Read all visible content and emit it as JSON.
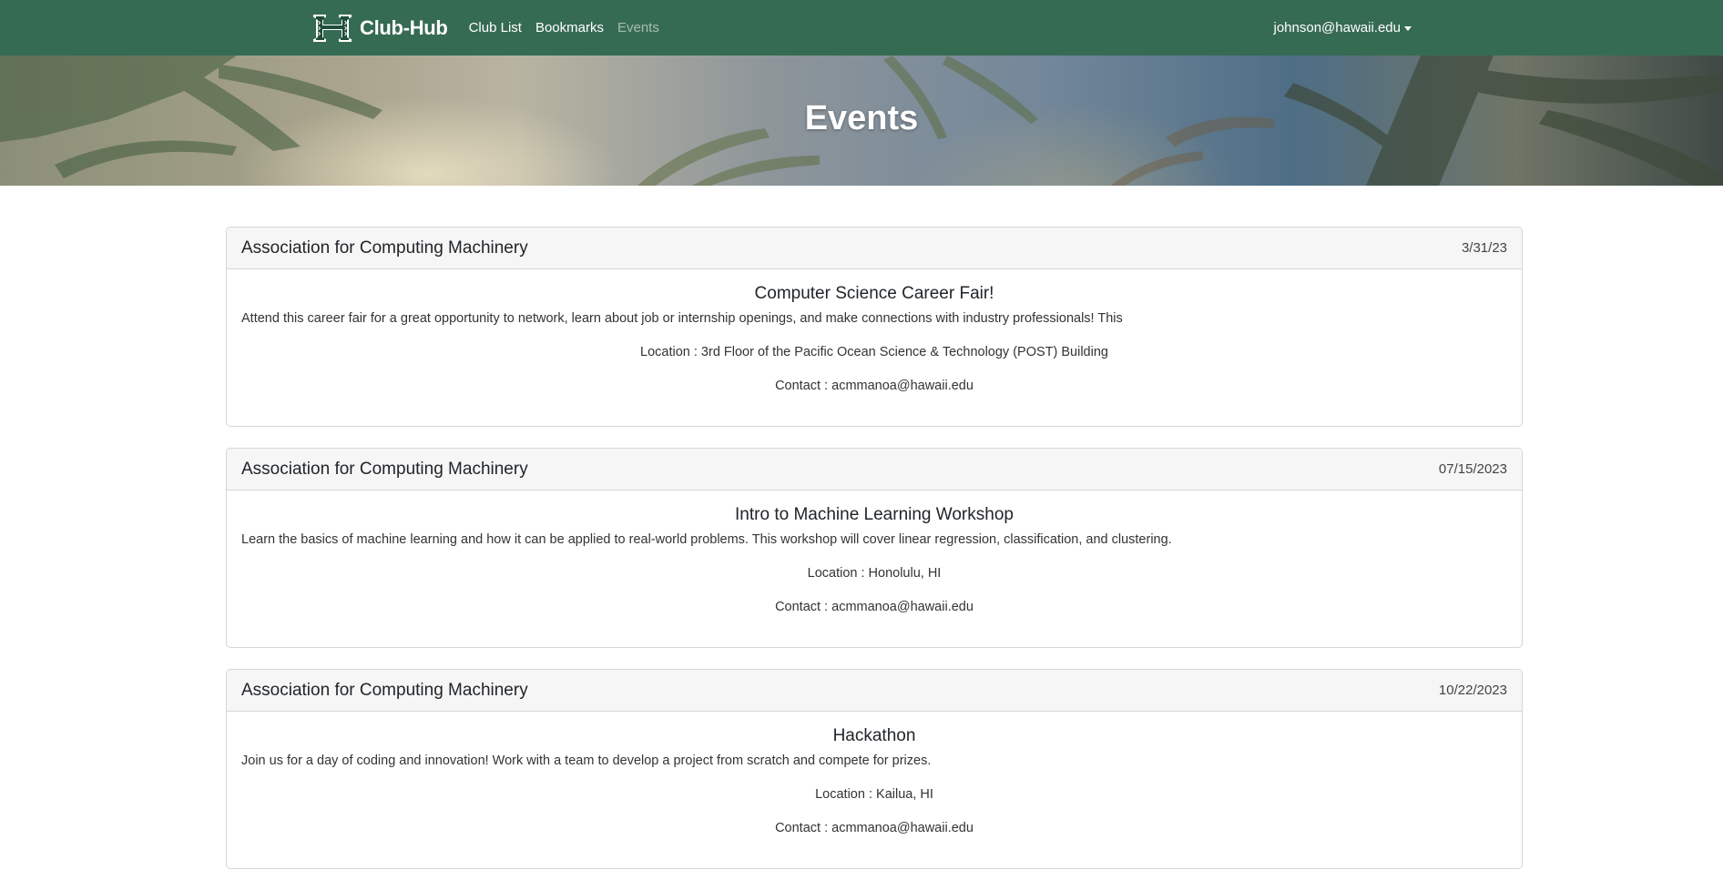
{
  "navbar": {
    "brand": "Club-Hub",
    "links": [
      {
        "label": "Club List"
      },
      {
        "label": "Bookmarks"
      },
      {
        "label": "Events"
      }
    ],
    "user": "johnson@hawaii.edu"
  },
  "hero": {
    "title": "Events"
  },
  "events": [
    {
      "club": "Association for Computing Machinery",
      "date": "3/31/23",
      "title": "Computer Science Career Fair!",
      "description": "Attend this career fair for a great opportunity to network, learn about job or internship openings, and make connections with industry professionals! This",
      "location": "Location : 3rd Floor of the Pacific Ocean Science & Technology (POST) Building",
      "contact": "Contact : acmmanoa@hawaii.edu"
    },
    {
      "club": "Association for Computing Machinery",
      "date": "07/15/2023",
      "title": "Intro to Machine Learning Workshop",
      "description": "Learn the basics of machine learning and how it can be applied to real-world problems. This workshop will cover linear regression, classification, and clustering.",
      "location": "Location : Honolulu, HI",
      "contact": "Contact : acmmanoa@hawaii.edu"
    },
    {
      "club": "Association for Computing Machinery",
      "date": "10/22/2023",
      "title": "Hackathon",
      "description": "Join us for a day of coding and innovation! Work with a team to develop a project from scratch and compete for prizes.",
      "location": "Location : Kailua, HI",
      "contact": "Contact : acmmanoa@hawaii.edu"
    }
  ],
  "colors": {
    "navbar": "#366b53",
    "card_header": "#f6f6f6",
    "card_border": "#d6d6d6"
  },
  "icons": {
    "logo": "hawaii-h-logo-icon",
    "user_caret": "caret-down-icon"
  }
}
